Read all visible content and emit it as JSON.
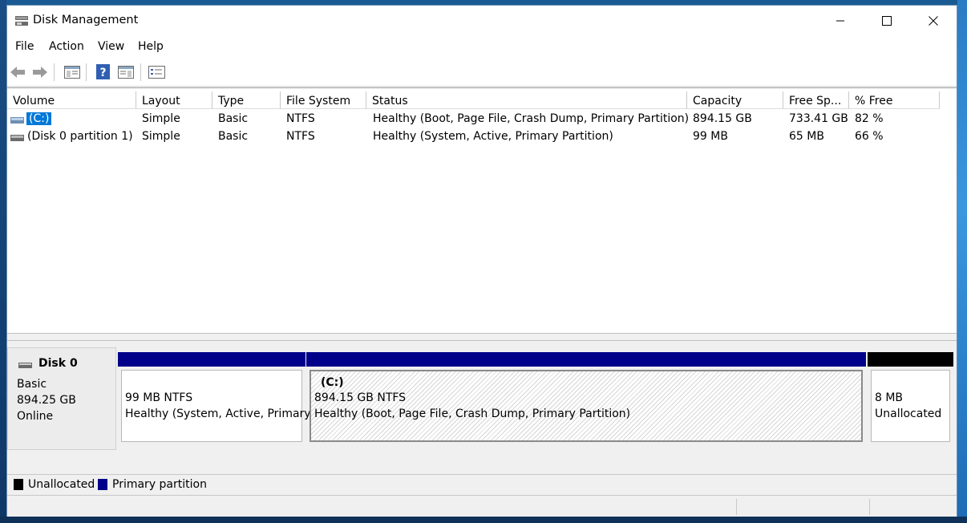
{
  "window": {
    "title": "Disk Management"
  },
  "menu": [
    "File",
    "Action",
    "View",
    "Help"
  ],
  "toolbar": {
    "icons": [
      "back-arrow-icon",
      "forward-arrow-icon",
      "show-hide-console-tree-icon",
      "help-icon",
      "show-hide-action-pane-icon",
      "properties-icon"
    ]
  },
  "volume_list": {
    "columns": [
      "Volume",
      "Layout",
      "Type",
      "File System",
      "Status",
      "Capacity",
      "Free Sp...",
      "% Free"
    ],
    "rows": [
      {
        "volume": "(C:)",
        "layout": "Simple",
        "type": "Basic",
        "fs": "NTFS",
        "status": "Healthy (Boot, Page File, Crash Dump, Primary Partition)",
        "capacity": "894.15 GB",
        "free": "733.41 GB",
        "pct_free": "82 %",
        "selected": true
      },
      {
        "volume": "(Disk 0 partition 1)",
        "layout": "Simple",
        "type": "Basic",
        "fs": "NTFS",
        "status": "Healthy (System, Active, Primary Partition)",
        "capacity": "99 MB",
        "free": "65 MB",
        "pct_free": "66 %",
        "selected": false
      }
    ]
  },
  "disk": {
    "name": "Disk 0",
    "kind": "Basic",
    "size": "894.25 GB",
    "state": "Online",
    "partitions": [
      {
        "label": "",
        "size_fs": "99 MB NTFS",
        "status": "Healthy (System, Active, Primary",
        "bar_color": "#00008b"
      },
      {
        "label": "(C:)",
        "size_fs": "894.15 GB NTFS",
        "status": "Healthy (Boot, Page File, Crash Dump, Primary Partition)",
        "bar_color": "#00008b"
      },
      {
        "label": "",
        "size_fs": "8 MB",
        "status": "Unallocated",
        "bar_color": "#000000"
      }
    ]
  },
  "legend": [
    {
      "label": "Unallocated",
      "color": "#000000"
    },
    {
      "label": "Primary partition",
      "color": "#00008b"
    }
  ]
}
